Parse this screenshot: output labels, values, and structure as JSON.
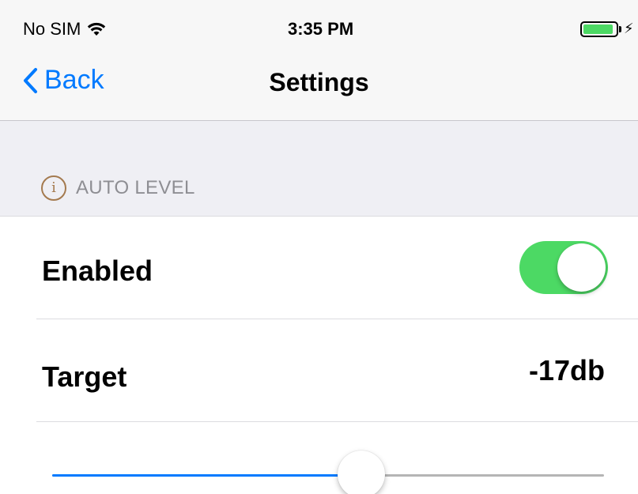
{
  "status_bar": {
    "carrier": "No SIM",
    "time": "3:35 PM",
    "battery_level": 0.92,
    "charging_icon": "bolt-icon"
  },
  "nav": {
    "back_label": "Back",
    "title": "Settings"
  },
  "section": {
    "icon": "info-icon",
    "icon_glyph": "i",
    "title": "AUTO LEVEL"
  },
  "rows": {
    "enabled": {
      "label": "Enabled",
      "on": true
    },
    "target": {
      "label": "Target",
      "value": "-17db"
    }
  },
  "slider": {
    "fraction": 0.56
  },
  "colors": {
    "accent": "#007aff",
    "toggle_on": "#4cd964",
    "info_icon": "#a47a4f"
  }
}
